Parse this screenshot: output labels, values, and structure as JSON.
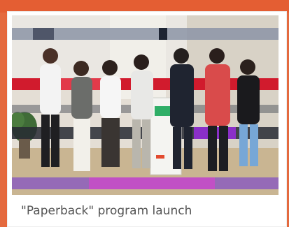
{
  "caption": "\"Paperback\" program launch",
  "photo": {
    "people_count": 7
  },
  "colors": {
    "frame_orange": "#e8663a",
    "card": "#ffffff",
    "caption_text": "#555555"
  }
}
